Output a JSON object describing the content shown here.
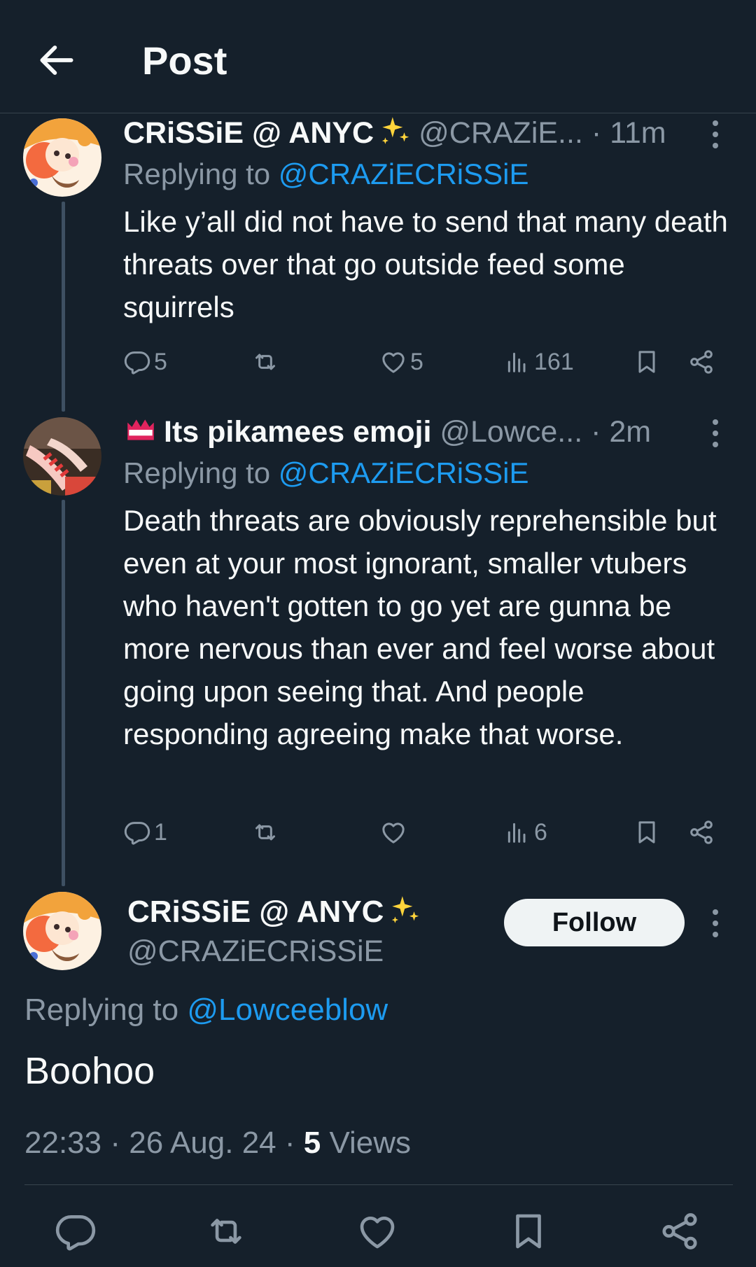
{
  "header": {
    "title": "Post"
  },
  "replies": [
    {
      "display_name": "CRiSSiE @ ANYC",
      "handle": "@CRAZiE...",
      "time": "11m",
      "replying_label": "Replying to",
      "replying_to": "@CRAZiECRiSSiE",
      "text": "Like y’all did not have to send that many death threats over that go outside feed some squirrels",
      "replies_count": "5",
      "retweets_count": "",
      "likes_count": "5",
      "views_count": "161"
    },
    {
      "display_name": "Its pikamees emoji",
      "handle": "@Lowce...",
      "time": "2m",
      "replying_label": "Replying to",
      "replying_to": "@CRAZiECRiSSiE",
      "text": "Death threats are obviously reprehensible but even at your most ignorant, smaller vtubers who haven't gotten to go yet are gunna be more nervous than ever and feel worse about going upon seeing that. And people responding agreeing make that worse.",
      "replies_count": "1",
      "retweets_count": "",
      "likes_count": "",
      "views_count": "6"
    }
  ],
  "main_post": {
    "display_name": "CRiSSiE @ ANYC",
    "handle": "@CRAZiECRiSSiE",
    "follow_label": "Follow",
    "replying_label": "Replying to",
    "replying_to": "@Lowceeblow",
    "text": "Boohoo",
    "time": "22:33",
    "date": "26 Aug. 24",
    "views_count": "5",
    "views_label": "Views"
  },
  "colors": {
    "background": "#15202b",
    "accent": "#1d9bf0",
    "secondary_text": "#8b98a5",
    "primary_text": "#f7f9f9"
  },
  "icons": {
    "back": "arrow-left-icon",
    "reply": "speech-bubble-icon",
    "retweet": "retweet-icon",
    "like": "heart-icon",
    "views": "bar-chart-icon",
    "bookmark": "bookmark-icon",
    "share": "share-icon",
    "more": "vertical-dots-icon",
    "sparkle": "sparkles-icon"
  }
}
